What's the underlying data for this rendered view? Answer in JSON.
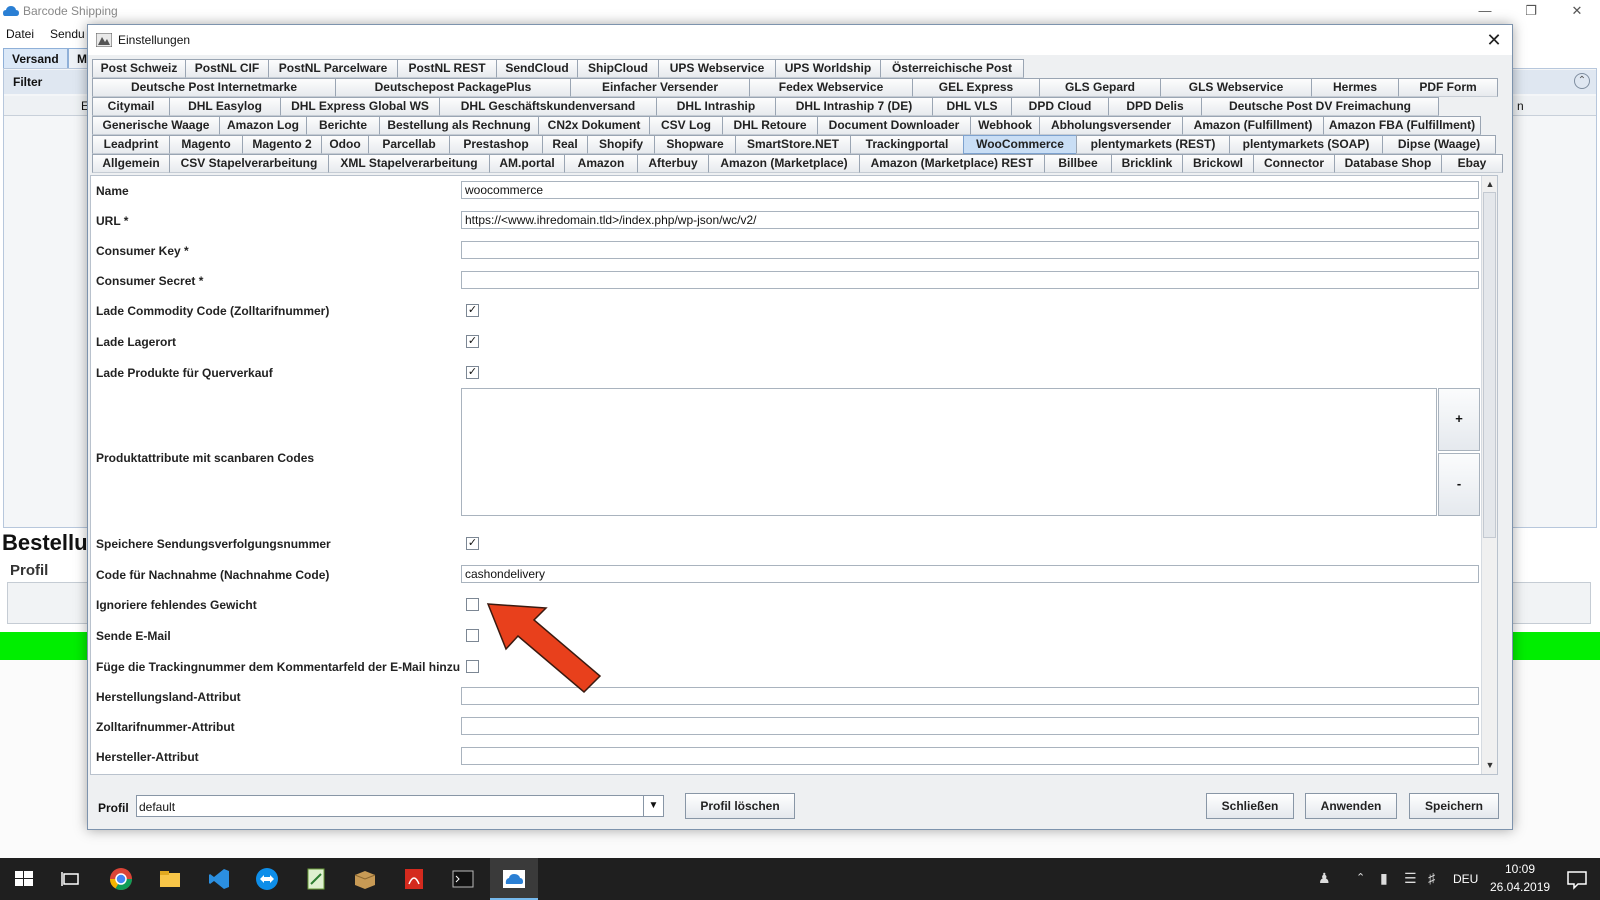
{
  "main_window": {
    "title": "Barcode Shipping",
    "menu": [
      "Datei",
      "Sendu"
    ],
    "tabs": [
      "Versand",
      "M"
    ],
    "filter_label": "Filter",
    "col_fragment_left": "E",
    "col_fragment_right": "n",
    "bestell_label": "Bestellu",
    "profil_label": "Profil"
  },
  "dialog": {
    "title": "Einstellungen",
    "tab_rows": [
      [
        "Post Schweiz",
        "PostNL CIF",
        "PostNL Parcelware",
        "PostNL REST",
        "SendCloud",
        "ShipCloud",
        "UPS Webservice",
        "UPS Worldship",
        "Österreichische Post"
      ],
      [
        "Deutsche Post Internetmarke",
        "Deutschepost PackagePlus",
        "Einfacher Versender",
        "Fedex Webservice",
        "GEL Express",
        "GLS Gepard",
        "GLS Webservice",
        "Hermes",
        "PDF Form"
      ],
      [
        "Citymail",
        "DHL Easylog",
        "DHL Express Global WS",
        "DHL Geschäftskundenversand",
        "DHL Intraship",
        "DHL Intraship 7 (DE)",
        "DHL VLS",
        "DPD Cloud",
        "DPD Delis",
        "Deutsche Post DV Freimachung"
      ],
      [
        "Generische Waage",
        "Amazon Log",
        "Berichte",
        "Bestellung als Rechnung",
        "CN2x Dokument",
        "CSV Log",
        "DHL Retoure",
        "Document Downloader",
        "Webhook",
        "Abholungsversender",
        "Amazon (Fulfillment)",
        "Amazon FBA (Fulfillment)"
      ],
      [
        "Leadprint",
        "Magento",
        "Magento 2",
        "Odoo",
        "Parcellab",
        "Prestashop",
        "Real",
        "Shopify",
        "Shopware",
        "SmartStore.NET",
        "Trackingportal",
        "WooCommerce",
        "plentymarkets (REST)",
        "plentymarkets (SOAP)",
        "Dipse (Waage)"
      ],
      [
        "Allgemein",
        "CSV Stapelverarbeitung",
        "XML Stapelverarbeitung",
        "AM.portal",
        "Amazon",
        "Afterbuy",
        "Amazon (Marketplace)",
        "Amazon (Marketplace) REST",
        "Billbee",
        "Bricklink",
        "Brickowl",
        "Connector",
        "Database Shop",
        "Ebay"
      ]
    ],
    "active_tab": "WooCommerce",
    "fields": {
      "name": {
        "label": "Name",
        "value": "woocommerce"
      },
      "url": {
        "label": "URL *",
        "value": "https://<www.ihredomain.tld>/index.php/wp-json/wc/v2/"
      },
      "consumer_key": {
        "label": "Consumer Key *",
        "value": ""
      },
      "consumer_secret": {
        "label": "Consumer Secret *",
        "value": ""
      },
      "commodity": {
        "label": "Lade Commodity Code (Zolltarifnummer)",
        "checked": true
      },
      "lagerort": {
        "label": "Lade Lagerort",
        "checked": true
      },
      "querverkauf": {
        "label": "Lade Produkte für Querverkauf",
        "checked": true
      },
      "produktattribute": {
        "label": "Produktattribute mit scanbaren Codes",
        "add": "+",
        "remove": "-"
      },
      "sendungsverfolgung": {
        "label": "Speichere Sendungsverfolgungsnummer",
        "checked": true
      },
      "nachnahme": {
        "label": "Code für Nachnahme (Nachnahme Code)",
        "value": "cashondelivery"
      },
      "gewicht": {
        "label": "Ignoriere fehlendes Gewicht",
        "checked": false
      },
      "email": {
        "label": "Sende E-Mail",
        "checked": false
      },
      "tracking_kommentar": {
        "label": "Füge die Trackingnummer dem Kommentarfeld der E-Mail hinzu",
        "checked": false
      },
      "herstellungsland": {
        "label": "Herstellungsland-Attribut",
        "value": ""
      },
      "zolltarif": {
        "label": "Zolltarifnummer-Attribut",
        "value": ""
      },
      "hersteller": {
        "label": "Hersteller-Attribut",
        "value": ""
      }
    },
    "footer": {
      "profil_label": "Profil",
      "profil_value": "default",
      "delete_button": "Profil löschen",
      "close_button": "Schließen",
      "apply_button": "Anwenden",
      "save_button": "Speichern"
    }
  },
  "taskbar": {
    "language": "DEU",
    "time": "10:09",
    "date": "26.04.2019"
  },
  "colors": {
    "active_tab": "#c9def5",
    "green_bar": "#00ee00",
    "arrow": "#e8401c"
  }
}
